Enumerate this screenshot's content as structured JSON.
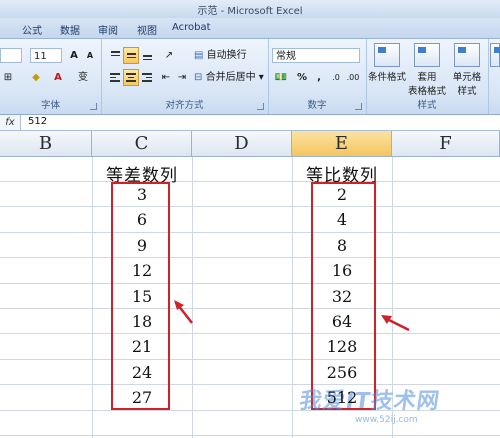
{
  "window": {
    "title": "示范 - Microsoft Excel"
  },
  "tabs": [
    "公式",
    "数据",
    "审阅",
    "视图",
    "Acrobat"
  ],
  "ribbon": {
    "font_size": "11",
    "wrap_text_label": "自动换行",
    "merge_center_label": "合并后居中",
    "number_format": "常规",
    "group_font": "字体",
    "group_alignment": "对齐方式",
    "group_number": "数字",
    "group_styles": "样式",
    "cond_format_label1": "条件格式",
    "table_format_label1": "套用",
    "table_format_label2": "表格格式",
    "cell_styles_label1": "单元格",
    "cell_styles_label2": "样式"
  },
  "formula_bar": {
    "fx": "fx",
    "value": "512"
  },
  "columns": [
    "B",
    "C",
    "D",
    "E",
    "F"
  ],
  "sheet": {
    "arith_header": "等差数列",
    "geo_header": "等比数列",
    "arith_values": [
      "3",
      "6",
      "9",
      "12",
      "15",
      "18",
      "21",
      "24",
      "27"
    ],
    "geo_values": [
      "2",
      "4",
      "8",
      "16",
      "32",
      "64",
      "128",
      "256",
      "512"
    ]
  },
  "watermark": {
    "text": "我爱IT技术网",
    "url": "www.52ij.com"
  },
  "colors": {
    "highlight_border": "#d0202a",
    "active_column": "#f4c55f"
  }
}
